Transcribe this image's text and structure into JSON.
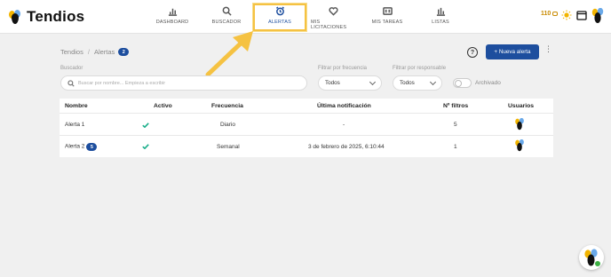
{
  "brand": {
    "name": "Tendios"
  },
  "nav": {
    "items": [
      {
        "label": "DASHBOARD",
        "icon": "bar-chart-icon"
      },
      {
        "label": "BUSCADOR",
        "icon": "search-icon"
      },
      {
        "label": "ALERTAS",
        "icon": "alarm-clock-icon"
      },
      {
        "label": "MIS LICITACIONES",
        "icon": "heart-icon"
      },
      {
        "label": "MIS TAREAS",
        "icon": "task-card-icon"
      },
      {
        "label": "LISTAS",
        "icon": "list-chart-icon"
      }
    ],
    "highlighted": "ALERTAS",
    "highlight_color": "#f5c242"
  },
  "topright": {
    "coins": "110"
  },
  "breadcrumb": {
    "root": "Tendios",
    "separator": "/",
    "current": "Alertas",
    "count": "2"
  },
  "actions": {
    "help": "?",
    "new_alert": "+ Nueva alerta",
    "more": "⋮"
  },
  "filters": {
    "search_label": "Buscador",
    "search_placeholder": "Buscar por nombre... Empieza a escribir",
    "frequency_label": "Filtrar por frecuencia",
    "frequency_value": "Todos",
    "responsible_label": "Filtrar por responsable",
    "responsible_value": "Todos",
    "archived_label": "Archivado"
  },
  "table": {
    "headers": [
      "Nombre",
      "Activo",
      "Frecuencia",
      "Última notificación",
      "Nº filtros",
      "Usuarios"
    ],
    "rows": [
      {
        "name": "Alerta 1",
        "badge": "",
        "active": true,
        "frequency": "Diario",
        "last": "-",
        "filters": "5"
      },
      {
        "name": "Alerta 2",
        "badge": "5",
        "active": true,
        "frequency": "Semanal",
        "last": "3 de febrero de 2025, 6:10:44",
        "filters": "1"
      }
    ]
  },
  "colors": {
    "primary": "#1d4e9e",
    "check": "#1aae8a",
    "accent": "#f5c242"
  }
}
